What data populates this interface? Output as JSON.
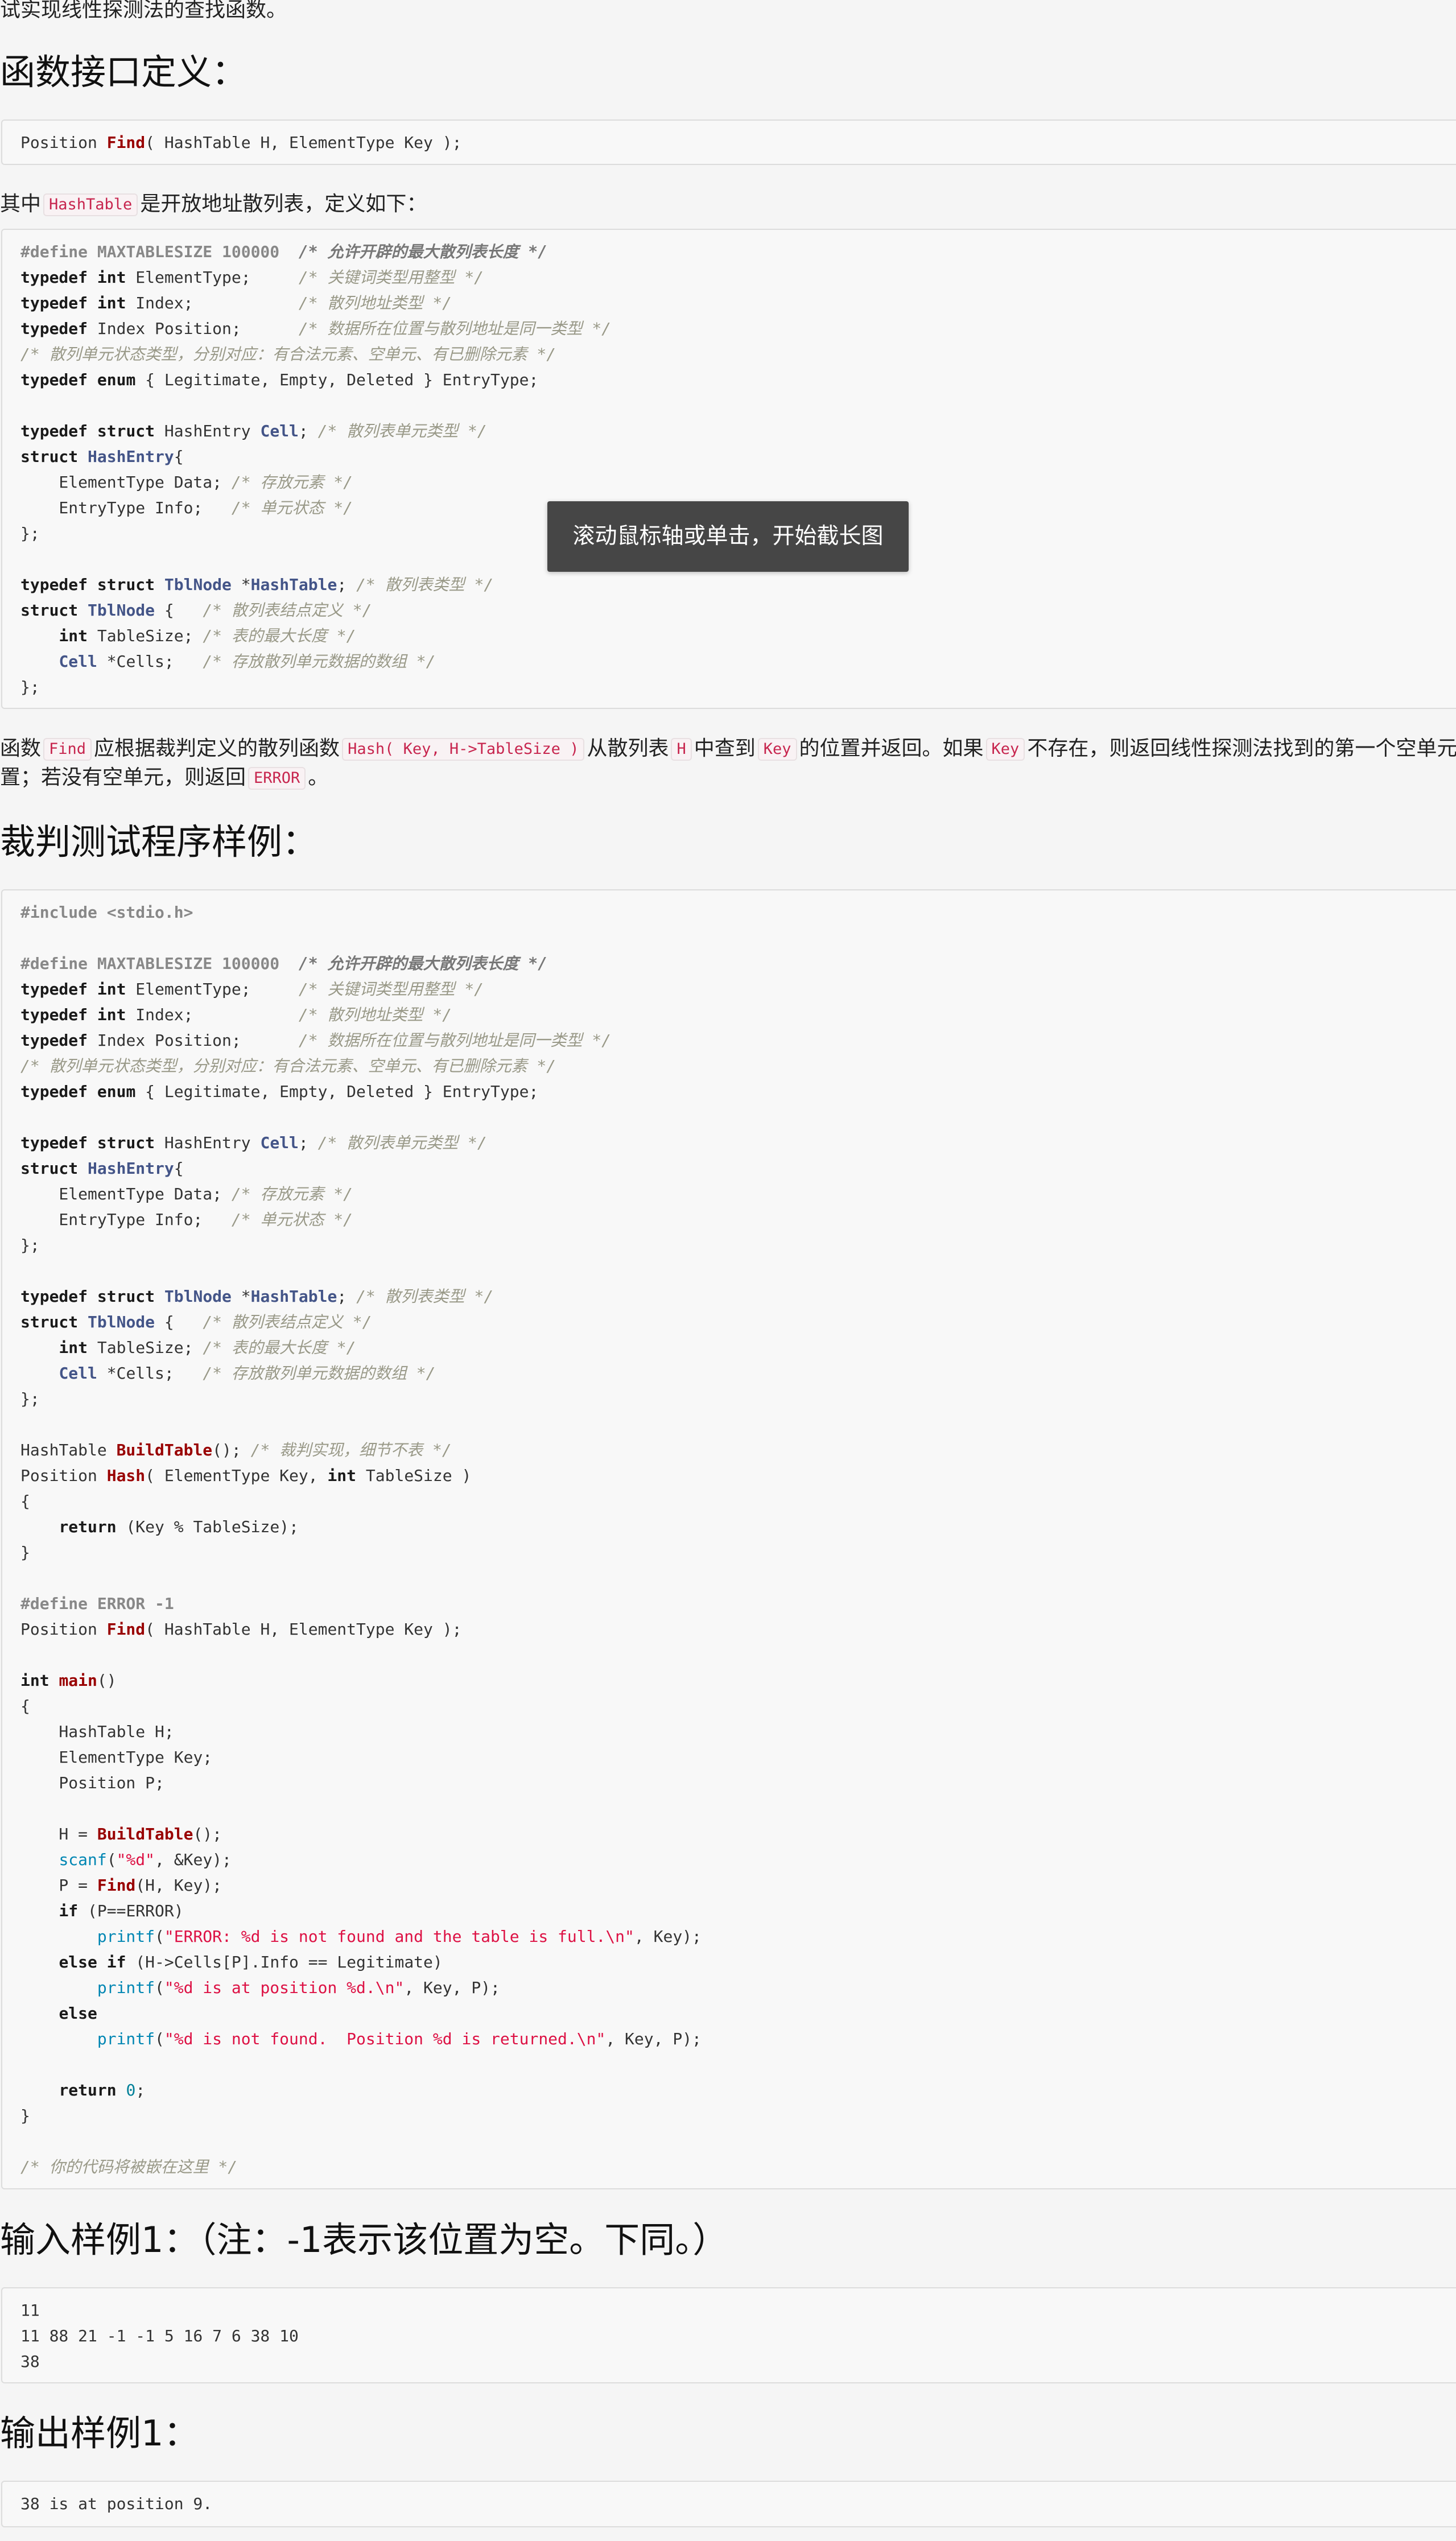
{
  "intro": "试实现线性探测法的查找函数。",
  "section_interface": {
    "heading": "函数接口定义：",
    "code": "Position Find( HashTable H, ElementType Key );"
  },
  "hashtable_desc": {
    "prefix": "其中",
    "code": "HashTable",
    "suffix": "是开放地址散列表，定义如下："
  },
  "typedef_code_lines": [
    "#define MAXTABLESIZE 100000  /* 允许开辟的最大散列表长度 */",
    "typedef int ElementType;     /* 关键词类型用整型 */",
    "typedef int Index;           /* 散列地址类型 */",
    "typedef Index Position;      /* 数据所在位置与散列地址是同一类型 */",
    "/* 散列单元状态类型，分别对应：有合法元素、空单元、有已删除元素 */",
    "typedef enum { Legitimate, Empty, Deleted } EntryType;",
    "",
    "typedef struct HashEntry Cell; /* 散列表单元类型 */",
    "struct HashEntry{",
    "    ElementType Data; /* 存放元素 */",
    "    EntryType Info;   /* 单元状态 */",
    "};",
    "",
    "typedef struct TblNode *HashTable; /* 散列表类型 */",
    "struct TblNode {   /* 散列表结点定义 */",
    "    int TableSize; /* 表的最大长度 */",
    "    Cell *Cells;   /* 存放散列单元数据的数组 */",
    "};"
  ],
  "toast": {
    "text": "滚动鼠标轴或单击，开始截长图"
  },
  "find_desc": {
    "t1": "函数",
    "c1": "Find",
    "t2": "应根据裁判定义的散列函数",
    "c2": "Hash( Key, H->TableSize )",
    "t3": "从散列表",
    "c3": "H",
    "t4": "中查到",
    "c4": "Key",
    "t5": "的位置并返回。如果",
    "c5": "Key",
    "t6": "不存在，则返回线性探测法找到的第一个空单元的位",
    "t7": "置；若没有空单元，则返回",
    "c6": "ERROR",
    "t8": "。"
  },
  "section_test": {
    "heading": "裁判测试程序样例："
  },
  "section_input": {
    "heading": "输入样例1：（注：-1表示该位置为空。下同。）",
    "lines": [
      "11",
      "11 88 21 -1 -1 5 16 7 6 38 10",
      "38"
    ]
  },
  "section_output": {
    "heading": "输出样例1：",
    "lines": [
      "38 is at position 9."
    ]
  }
}
